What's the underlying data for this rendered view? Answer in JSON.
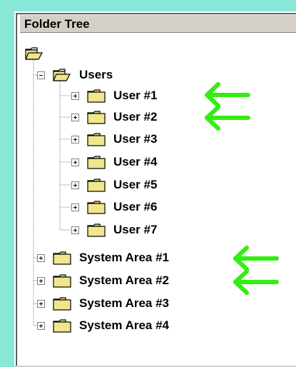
{
  "panel": {
    "title": "Folder Tree"
  },
  "tree": {
    "users_label": "Users",
    "user_items": [
      "User #1",
      "User #2",
      "User #3",
      "User #4",
      "User #5",
      "User #6",
      "User #7"
    ],
    "system_items": [
      "System Area #1",
      "System Area #2",
      "System Area #3",
      "System Area #4"
    ]
  },
  "icons": {
    "folder": "folder-icon",
    "expander_plus": "plus-box-icon",
    "expander_minus": "minus-box-icon",
    "arrow": "left-arrow-icon"
  },
  "colors": {
    "background": "#88e8d8",
    "folder_fill": "#f0e68c",
    "arrow": "#33ee11"
  }
}
